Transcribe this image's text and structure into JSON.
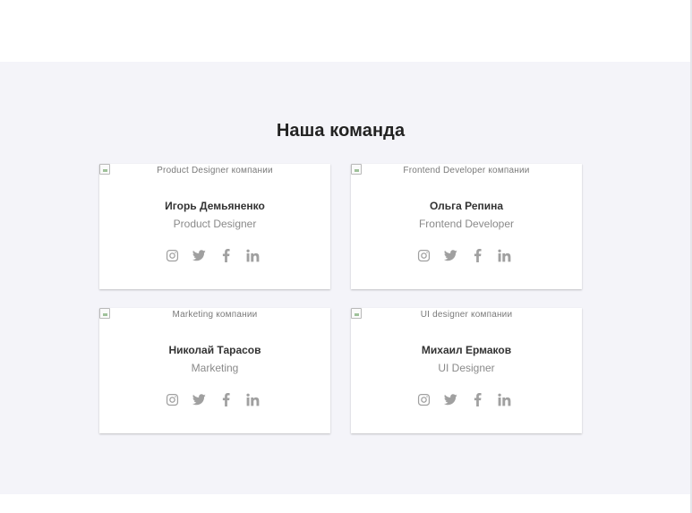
{
  "section": {
    "title": "Наша команда"
  },
  "icons": [
    "instagram-icon",
    "twitter-icon",
    "facebook-icon",
    "linkedin-icon"
  ],
  "colors": {
    "section_bg": "#f4f4f9",
    "card_bg": "#ffffff",
    "icon": "#a0a0a0",
    "name": "#333333",
    "role": "#8a8a8a"
  },
  "team": [
    {
      "image_alt": "Product Designer компании",
      "name": "Игорь Демьяненко",
      "role": "Product Designer"
    },
    {
      "image_alt": "Frontend Developer компании",
      "name": "Ольга Репина",
      "role": "Frontend Developer"
    },
    {
      "image_alt": "Marketing компании",
      "name": "Николай Тарасов",
      "role": "Marketing"
    },
    {
      "image_alt": "UI designer компании",
      "name": "Михаил Ермаков",
      "role": "UI Designer"
    }
  ]
}
